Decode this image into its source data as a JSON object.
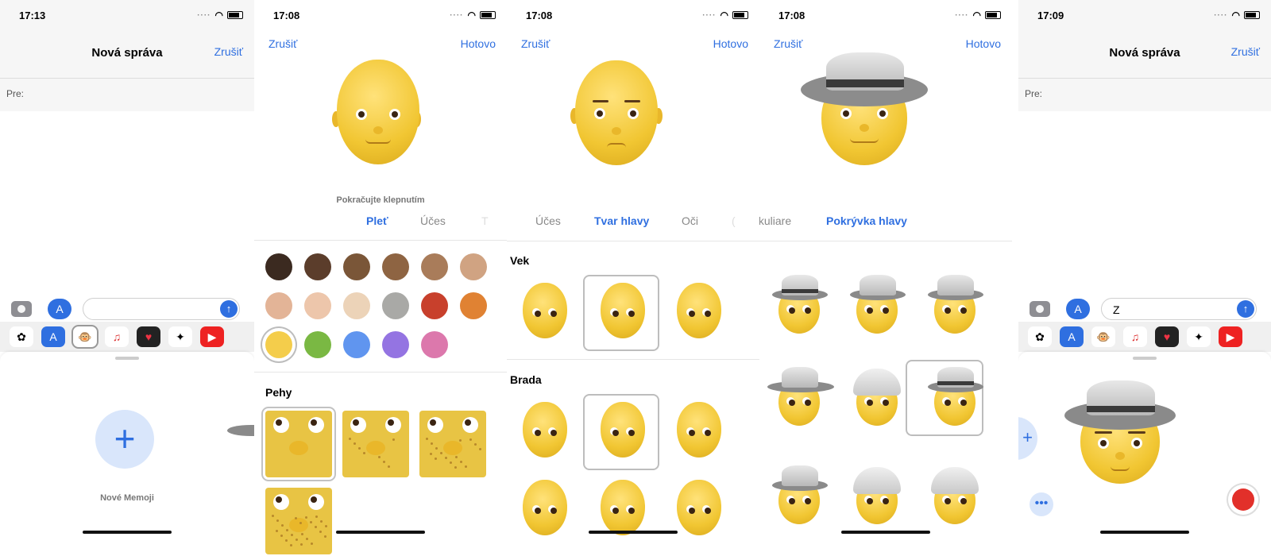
{
  "panels": [
    {
      "time": "17:13",
      "title": "Nová správa",
      "cancel": "Zrušiť",
      "to_label": "Pre:",
      "message_text": "",
      "memoji_caption": "Nové Memoji"
    },
    {
      "time": "17:08",
      "cancel": "Zrušiť",
      "done": "Hotovo",
      "hint": "Pokračujte klepnutím",
      "tabs": [
        "Pleť",
        "Účes",
        "T"
      ],
      "active_tab": "Pleť",
      "skin_colors": [
        "#3b2a20",
        "#5b3d2b",
        "#7a5638",
        "#8e6442",
        "#a97c5a",
        "#d0a382",
        "#e3b497",
        "#edc6ab",
        "#ecd3b8",
        "#a9a9a6",
        "#c8402c",
        "#e08233",
        "#f4cd4b",
        "#7ab843",
        "#6095ef",
        "#9474e2",
        "#dc78ac"
      ],
      "selected_skin": "#f4cd4b",
      "section": "Pehy"
    },
    {
      "time": "17:08",
      "cancel": "Zrušiť",
      "done": "Hotovo",
      "tabs": [
        "Účes",
        "Tvar hlavy",
        "Oči",
        "("
      ],
      "active_tab": "Tvar hlavy",
      "section_age": "Vek",
      "section_chin": "Brada"
    },
    {
      "time": "17:08",
      "cancel": "Zrušiť",
      "done": "Hotovo",
      "tabs": [
        "Okuliare",
        "Pokrývka hlavy"
      ],
      "active_tab": "Pokrývka hlavy"
    },
    {
      "time": "17:09",
      "title": "Nová správa",
      "cancel": "Zrušiť",
      "to_label": "Pre:",
      "message_text": "Z"
    }
  ],
  "icons": {
    "camera": "camera-icon",
    "appstore": "app-store-icon",
    "send": "send-arrow-icon",
    "plus": "plus-icon",
    "more": "ellipsis-icon",
    "record": "record-icon"
  },
  "colors": {
    "accent": "#2f6fe0",
    "record": "#e2302a",
    "memoji_yellow": "#f1c632"
  }
}
